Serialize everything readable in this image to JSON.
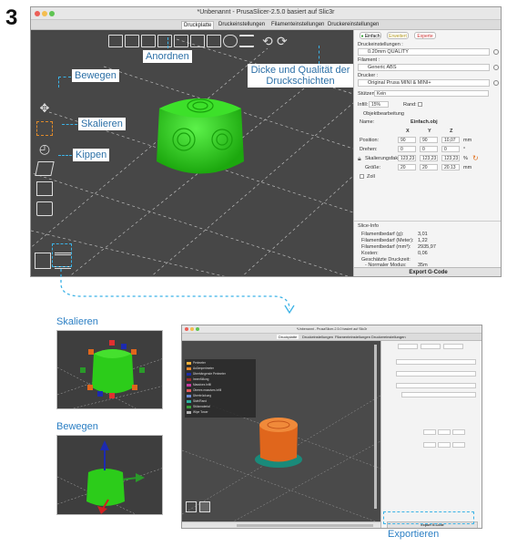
{
  "step_number": "3",
  "main_window": {
    "title": "*Unbenannt - PrusaSlicer-2.5.0 basiert auf Slic3r",
    "tabs": [
      {
        "label": "Druckplatte",
        "active": true
      },
      {
        "label": "Druckeinstellungen"
      },
      {
        "label": "Filamenteinstellungen"
      },
      {
        "label": "Druckereinstellungen"
      }
    ],
    "mode": {
      "simple": "Einfach",
      "advanced": "Erweitert",
      "expert": "Experte"
    },
    "panel": {
      "print_settings_label": "Druckeinstellungen :",
      "print_settings_value": "0.20mm QUALITY",
      "filament_label": "Filament :",
      "filament_value": "Generic ABS",
      "printer_label": "Drucker :",
      "printer_value": "Original Prusa MINI & MINI+",
      "supports_label": "Stützen:",
      "supports_value": "Kein",
      "infill_label": "Infill:",
      "infill_value": "15%",
      "brim_label": "Rand:",
      "object_manipulation": "Objektbearbeitung",
      "name_label": "Name:",
      "name_value": "Einfach.obj",
      "axes": [
        "X",
        "Y",
        "Z"
      ],
      "position_label": "Position:",
      "position": [
        "90",
        "90",
        "10,07"
      ],
      "position_unit": "mm",
      "rotation_label": "Drehen:",
      "rotation": [
        "0",
        "0",
        "0"
      ],
      "rotation_unit": "°",
      "scale_label": "Skalierungsfaktoren:",
      "scale": [
        "123,23",
        "123,23",
        "123,23"
      ],
      "scale_unit": "%",
      "size_label": "Größe:",
      "size": [
        "20",
        "20",
        "20.13"
      ],
      "size_unit": "mm",
      "inch_label": "Zoll",
      "info_title": "Slice-Info",
      "info": [
        {
          "label": "Filamentbedarf (g):",
          "value": "3,01"
        },
        {
          "label": "Filamentbedarf (Meter):",
          "value": "1,22"
        },
        {
          "label": "Filamentbedarf (mm³):",
          "value": "2935,97"
        },
        {
          "label": "Kosten:",
          "value": "0,06"
        },
        {
          "label": "Geschätzte Druckzeit:",
          "value": ""
        },
        {
          "label": "- Normaler Modus:",
          "value": "35m"
        }
      ],
      "export_button": "Export G-Code"
    }
  },
  "callouts": {
    "arrange": "Anordnen",
    "layers": "Dicke und Qualität der Druckschichten",
    "move": "Bewegen",
    "scale": "Skalieren",
    "tilt": "Kippen"
  },
  "lower": {
    "scale_title": "Skalieren",
    "move_title": "Bewegen",
    "export_label": "Exportieren"
  },
  "second_window": {
    "title": "*Unbenannt - PrusaSlicer-2.5.0 basiert auf Slic3r",
    "tabs": [
      "Druckplatte",
      "Druckeinstellungen",
      "Filamenteinstellungen",
      "Druckereinstellungen"
    ],
    "legend": [
      {
        "name": "Perimeter",
        "color": "#f2b03a"
      },
      {
        "name": "Außenperimeter",
        "color": "#e8862a"
      },
      {
        "name": "Überhängende Perimeter",
        "color": "#1a2aa8"
      },
      {
        "name": "Innenfüllung",
        "color": "#a02a2a"
      },
      {
        "name": "Massives Infill",
        "color": "#c73aa0"
      },
      {
        "name": "Oberes massives Infill",
        "color": "#e25a5a"
      },
      {
        "name": "Überbrückung",
        "color": "#6a8ad6"
      },
      {
        "name": "Skirt/Rand",
        "color": "#2ab0a0"
      },
      {
        "name": "Stützmaterial",
        "color": "#3aa03a"
      },
      {
        "name": "Wipe Tower",
        "color": "#b0b0b0"
      }
    ],
    "export_button": "Export G-Code"
  },
  "colors": {
    "accent": "#3bb2e6",
    "callout_text": "#2b6fa6",
    "object_green": "#2ccc1a",
    "object_orange": "#e0661c"
  }
}
